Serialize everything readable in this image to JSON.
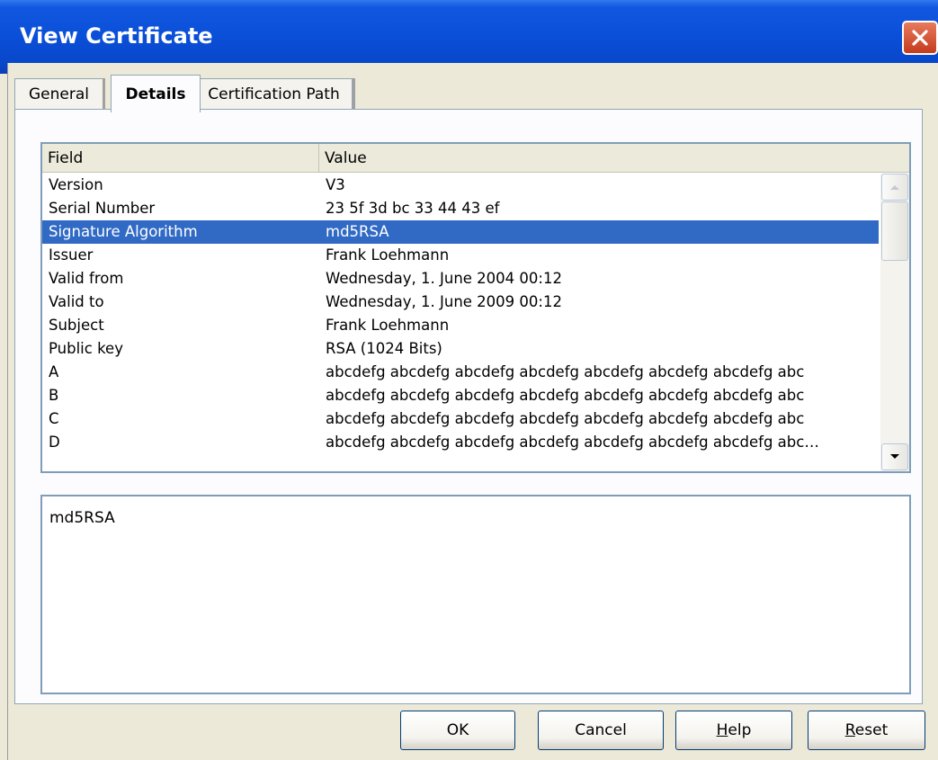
{
  "window": {
    "title": "View Certificate"
  },
  "tabs": [
    {
      "label": "General",
      "active": false
    },
    {
      "label": "Details",
      "active": true
    },
    {
      "label": "Certification Path",
      "active": false
    }
  ],
  "list": {
    "columns": {
      "field": "Field",
      "value": "Value"
    },
    "rows": [
      {
        "field": "Version",
        "value": "V3"
      },
      {
        "field": "Serial Number",
        "value": "23 5f 3d bc 33 44 43 ef"
      },
      {
        "field": "Signature Algorithm",
        "value": "md5RSA",
        "selected": true
      },
      {
        "field": "Issuer",
        "value": "Frank Loehmann"
      },
      {
        "field": "Valid from",
        "value": "Wednesday, 1. June 2004 00:12"
      },
      {
        "field": "Valid to",
        "value": "Wednesday, 1. June 2009 00:12"
      },
      {
        "field": "Subject",
        "value": "Frank Loehmann"
      },
      {
        "field": "Public key",
        "value": "RSA (1024 Bits)"
      },
      {
        "field": "A",
        "value": "abcdefg abcdefg abcdefg abcdefg abcdefg abcdefg abcdefg abc"
      },
      {
        "field": "B",
        "value": "abcdefg abcdefg abcdefg abcdefg abcdefg abcdefg abcdefg abc"
      },
      {
        "field": "C",
        "value": "abcdefg abcdefg abcdefg abcdefg abcdefg abcdefg abcdefg abc"
      },
      {
        "field": "D",
        "value": "abcdefg abcdefg abcdefg abcdefg abcdefg abcdefg abcdefg abc…"
      }
    ]
  },
  "detail": {
    "text": "md5RSA"
  },
  "buttons": {
    "ok": "OK",
    "cancel": "Cancel",
    "help_prefix": "H",
    "help_rest": "elp",
    "reset_prefix": "R",
    "reset_rest": "eset"
  },
  "icons": {
    "close": "close-icon",
    "scroll_up": "arrow-up-icon",
    "scroll_down": "arrow-down-icon"
  },
  "colors": {
    "title_bar": "#0a4fd8",
    "selection": "#316ac5",
    "close_button": "#c53b1d"
  }
}
